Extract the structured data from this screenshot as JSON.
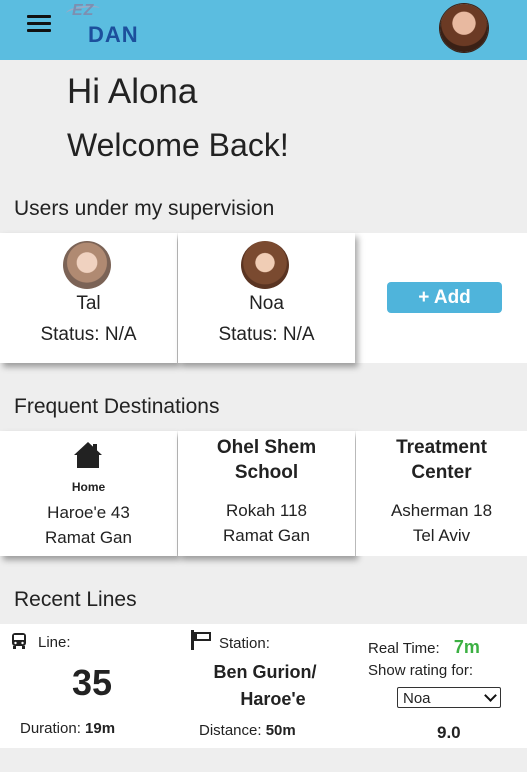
{
  "header": {
    "logo_ez": "EZ",
    "logo_dan": "DAN"
  },
  "greeting": {
    "hi": "Hi Alona",
    "welcome": "Welcome Back!"
  },
  "supervision": {
    "title": "Users under my supervision",
    "users": [
      {
        "name": "Tal",
        "status": "Status: N/A"
      },
      {
        "name": "Noa",
        "status": "Status: N/A"
      }
    ],
    "add_label": "+ Add"
  },
  "destinations": {
    "title": "Frequent Destinations",
    "items": [
      {
        "title": "Home",
        "line1": "Haroe'e 43",
        "line2": "Ramat Gan"
      },
      {
        "title": "Ohel Shem School",
        "title_a": "Ohel Shem",
        "title_b": "School",
        "line1": "Rokah 118",
        "line2": "Ramat Gan"
      },
      {
        "title": "Treatment Center",
        "title_a": "Treatment",
        "title_b": "Center",
        "line1": "Asherman 18",
        "line2": "Tel Aviv"
      }
    ]
  },
  "recent": {
    "title": "Recent Lines",
    "line_label": "Line:",
    "line_number": "35",
    "duration_label": "Duration:",
    "duration_value": "19m",
    "station_label": "Station:",
    "station_a": "Ben Gurion/",
    "station_b": "Haroe'e",
    "distance_label": "Distance:",
    "distance_value": "50m",
    "realtime_label": "Real Time:",
    "realtime_value": "7m",
    "rating_label": "Show rating for:",
    "rating_selected": "Noa",
    "rating_value": "9.0",
    "colors": {
      "realtime": "#3cb043"
    }
  },
  "colors": {
    "topbar": "#5bbde0",
    "accent_button": "#4fb4db",
    "logo": "#1c4f9c"
  },
  "icons": [
    "menu-icon",
    "bus-icon",
    "flag-icon",
    "home-icon"
  ]
}
